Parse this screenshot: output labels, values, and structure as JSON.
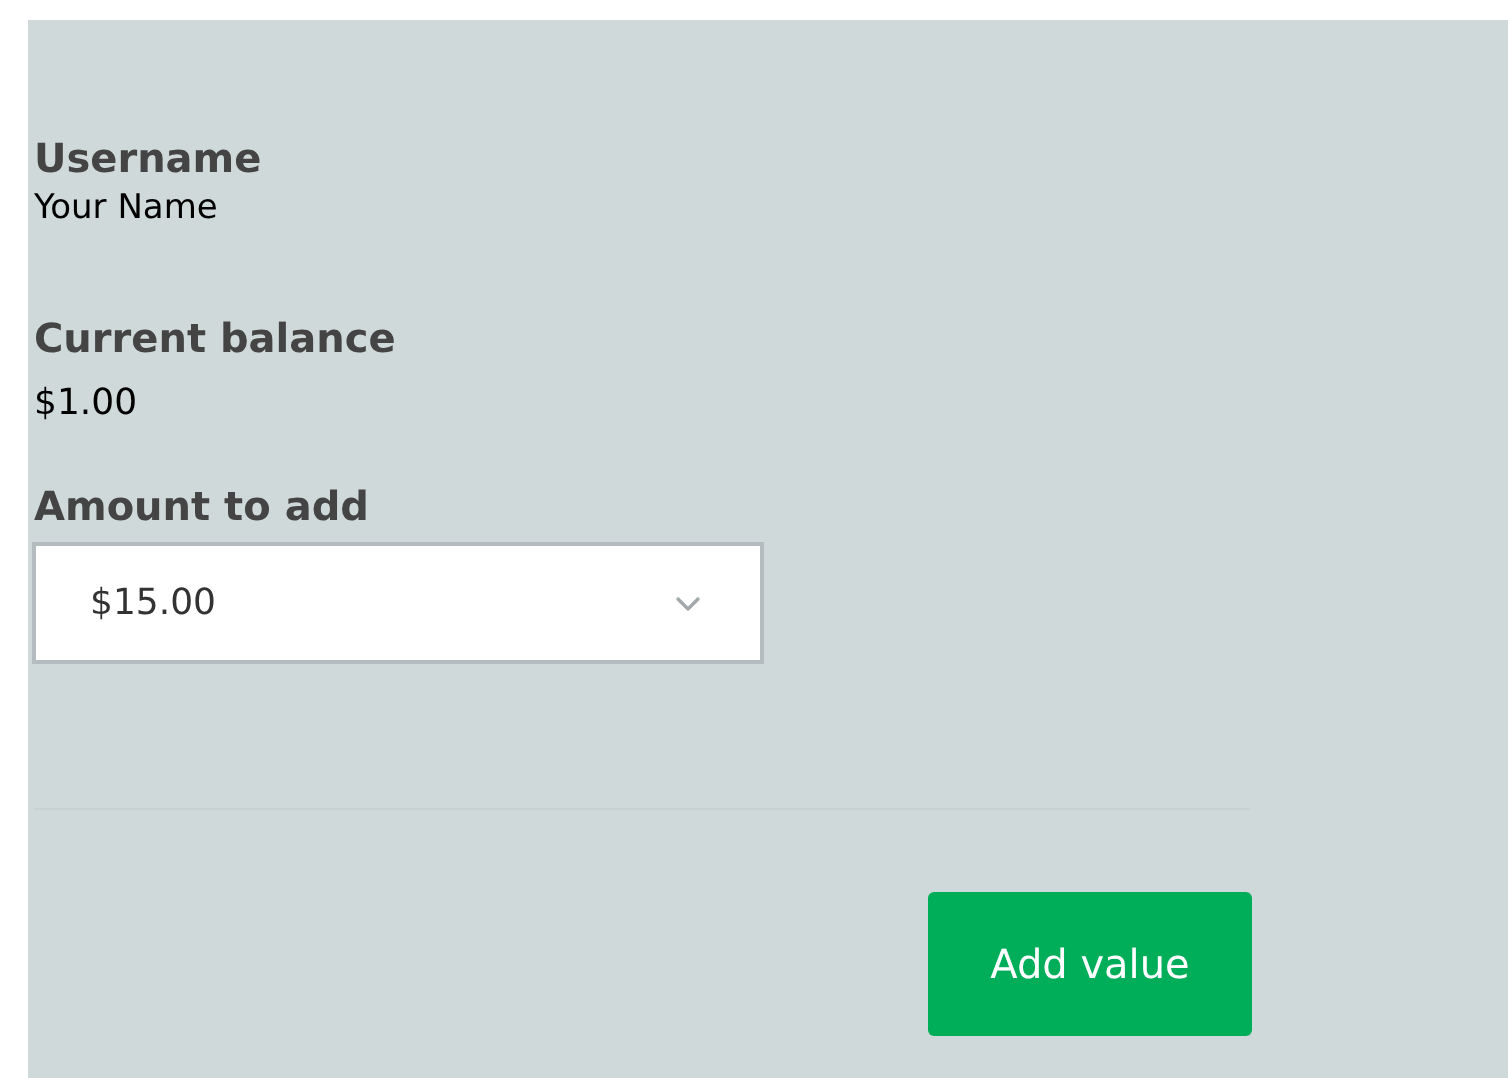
{
  "username": {
    "label": "Username",
    "value": "Your Name"
  },
  "balance": {
    "label": "Current balance",
    "value": "$1.00"
  },
  "amount": {
    "label": "Amount to add",
    "value": "$15.00"
  },
  "button": {
    "label": "Add value"
  }
}
